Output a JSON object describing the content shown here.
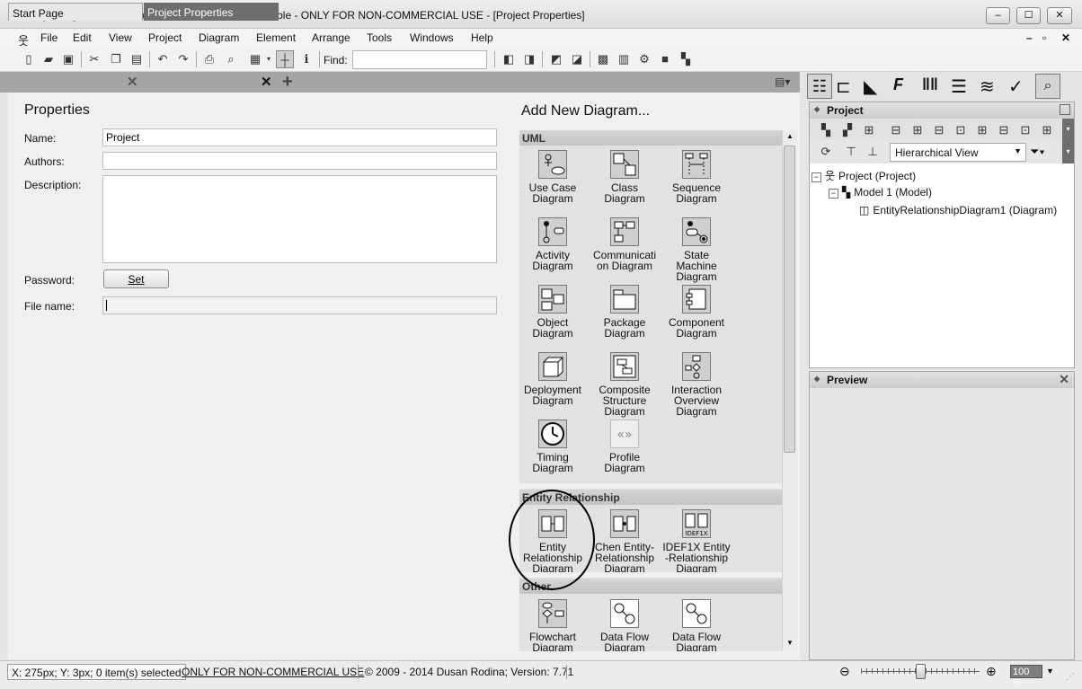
{
  "window": {
    "title": "Project * ()  - Software Ideas Modeler Standard Portable - ONLY FOR NON-COMMERCIAL USE - [Project Properties]",
    "controls": [
      "–",
      "☐",
      "✕"
    ]
  },
  "menu": [
    "File",
    "Edit",
    "View",
    "Project",
    "Diagram",
    "Element",
    "Arrange",
    "Tools",
    "Windows",
    "Help"
  ],
  "menu_right": [
    "–",
    "▫",
    "✕"
  ],
  "toolbar": {
    "find_label": "Find:",
    "find_value": ""
  },
  "tabs": [
    {
      "label": "Start Page"
    },
    {
      "label": "Project Properties"
    }
  ],
  "properties": {
    "title": "Properties",
    "name_label": "Name:",
    "name_value": "Project",
    "authors_label": "Authors:",
    "authors_value": "",
    "description_label": "Description:",
    "password_label": "Password:",
    "set_button": "Set",
    "filename_label": "File name:",
    "filename_value": ""
  },
  "add_diagram": {
    "title": "Add New Diagram...",
    "categories": [
      "UML",
      "Entity Relationship",
      "Other"
    ],
    "uml": [
      {
        "l1": "Use Case",
        "l2": "Diagram",
        "l3": ""
      },
      {
        "l1": "Class",
        "l2": "Diagram",
        "l3": ""
      },
      {
        "l1": "Sequence",
        "l2": "Diagram",
        "l3": ""
      },
      {
        "l1": "Activity",
        "l2": "Diagram",
        "l3": ""
      },
      {
        "l1": "Communicati",
        "l2": "on Diagram",
        "l3": ""
      },
      {
        "l1": "State",
        "l2": "Machine",
        "l3": "Diagram"
      },
      {
        "l1": "Object",
        "l2": "Diagram",
        "l3": ""
      },
      {
        "l1": "Package",
        "l2": "Diagram",
        "l3": ""
      },
      {
        "l1": "Component",
        "l2": "Diagram",
        "l3": ""
      },
      {
        "l1": "Deployment",
        "l2": "Diagram",
        "l3": ""
      },
      {
        "l1": "Composite",
        "l2": "Structure",
        "l3": "Diagram"
      },
      {
        "l1": "Interaction",
        "l2": "Overview",
        "l3": "Diagram"
      },
      {
        "l1": "Timing",
        "l2": "Diagram",
        "l3": ""
      },
      {
        "l1": "Profile",
        "l2": "Diagram",
        "l3": ""
      }
    ],
    "er": [
      {
        "l1": "Entity",
        "l2": "Relationship",
        "l3": "Diagram"
      },
      {
        "l1": "Chen Entity-",
        "l2": "Relationship",
        "l3": "Diagram"
      },
      {
        "l1": "IDEF1X Entity",
        "l2": "-Relationship",
        "l3": "Diagram"
      }
    ],
    "other": [
      {
        "l1": "Flowchart",
        "l2": "Diagram",
        "l3": ""
      },
      {
        "l1": "Data Flow",
        "l2": "Diagram",
        "l3": ""
      },
      {
        "l1": "Data Flow",
        "l2": "Diagram",
        "l3": ""
      }
    ],
    "idef1x_icon_text": "IDEF1X"
  },
  "project_panel": {
    "title": "Project",
    "view_select": "Hierarchical View",
    "tree": [
      {
        "label": "Project (Project)"
      },
      {
        "label": "Model 1 (Model)"
      },
      {
        "label": "EntityRelationshipDiagram1 (Diagram)"
      }
    ]
  },
  "preview_panel": {
    "title": "Preview"
  },
  "status": {
    "coords": "X: 275px; Y: 3px; 0 item(s) selected",
    "license": "ONLY FOR NON-COMMERCIAL USE",
    "copyright": "© 2009 - 2014 Dusan Rodina; Version: 7.71",
    "zoom": "100 %"
  }
}
